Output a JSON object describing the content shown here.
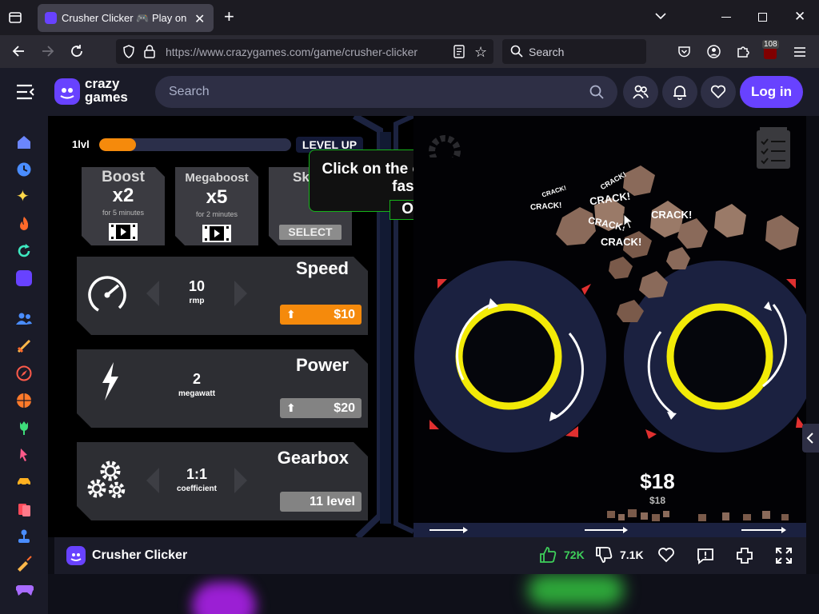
{
  "browser": {
    "tab_title": "Crusher Clicker 🎮 Play on Cra",
    "url": "https://www.crazygames.com/game/crusher-clicker",
    "search_placeholder": "Search",
    "extension_badge": "108"
  },
  "site": {
    "logo_line1": "crazy",
    "logo_line2": "games",
    "search_placeholder": "Search",
    "login_label": "Log in"
  },
  "game": {
    "level_label": "1lvl",
    "level_progress": 0.19,
    "level_up_label": "LEVEL UP",
    "boost": {
      "title": "Boost",
      "mult": "x2",
      "duration": "for 5 minutes"
    },
    "megaboost": {
      "title": "Megaboost",
      "mult": "x5",
      "duration": "for 2 minutes"
    },
    "skin": {
      "title": "Sk",
      "button": "SELECT"
    },
    "tooltip": {
      "text": "Click on the ore to split it faster",
      "ok": "OK"
    },
    "speed": {
      "title": "Speed",
      "value": "10",
      "unit": "rmp",
      "price": "$10"
    },
    "power": {
      "title": "Power",
      "value": "2",
      "unit": "megawatt",
      "price": "$20"
    },
    "gearbox": {
      "title": "Gearbox",
      "value": "1:1",
      "unit": "coefficient",
      "button": "11 level"
    },
    "crack_labels": [
      "CRACK!",
      "CRACK!",
      "CRACK!",
      "CRACK!",
      "CRACK!",
      "CRACK!",
      "CRACK!"
    ],
    "money": "$18",
    "money_small": "$18"
  },
  "footer": {
    "game_title": "Crusher Clicker",
    "likes": "72K",
    "dislikes": "7.1K"
  },
  "colors": {
    "accent": "#6842ff",
    "orange": "#f58a0c",
    "yellow_ring": "#f2ea07",
    "tooltip_border": "#16b31a"
  }
}
